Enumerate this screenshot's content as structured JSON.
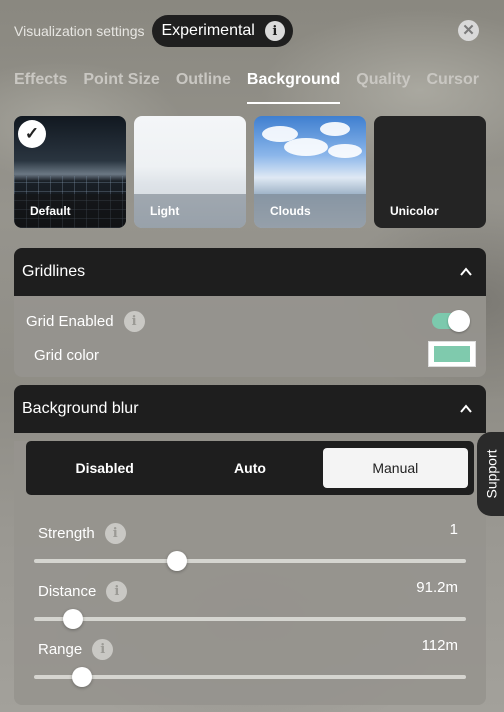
{
  "header": {
    "title": "Visualization settings",
    "badge_label": "Experimental"
  },
  "tabs": [
    {
      "label": "Effects",
      "active": false
    },
    {
      "label": "Point Size",
      "active": false
    },
    {
      "label": "Outline",
      "active": false
    },
    {
      "label": "Background",
      "active": true
    },
    {
      "label": "Quality",
      "active": false
    },
    {
      "label": "Cursor",
      "active": false
    }
  ],
  "backgrounds": [
    {
      "label": "Default",
      "selected": true
    },
    {
      "label": "Light",
      "selected": false
    },
    {
      "label": "Clouds",
      "selected": false
    },
    {
      "label": "Unicolor",
      "selected": false
    }
  ],
  "gridlines": {
    "title": "Gridlines",
    "grid_enabled_label": "Grid Enabled",
    "grid_enabled": true,
    "grid_color_label": "Grid color",
    "grid_color": "#7fcaad"
  },
  "blur": {
    "title": "Background blur",
    "modes": [
      "Disabled",
      "Auto",
      "Manual"
    ],
    "selected_mode": "Manual",
    "sliders": [
      {
        "label": "Strength",
        "value_text": "1",
        "fraction": 0.33
      },
      {
        "label": "Distance",
        "value_text": "91.2m",
        "fraction": 0.09
      },
      {
        "label": "Range",
        "value_text": "112m",
        "fraction": 0.11
      }
    ]
  },
  "support_label": "Support"
}
